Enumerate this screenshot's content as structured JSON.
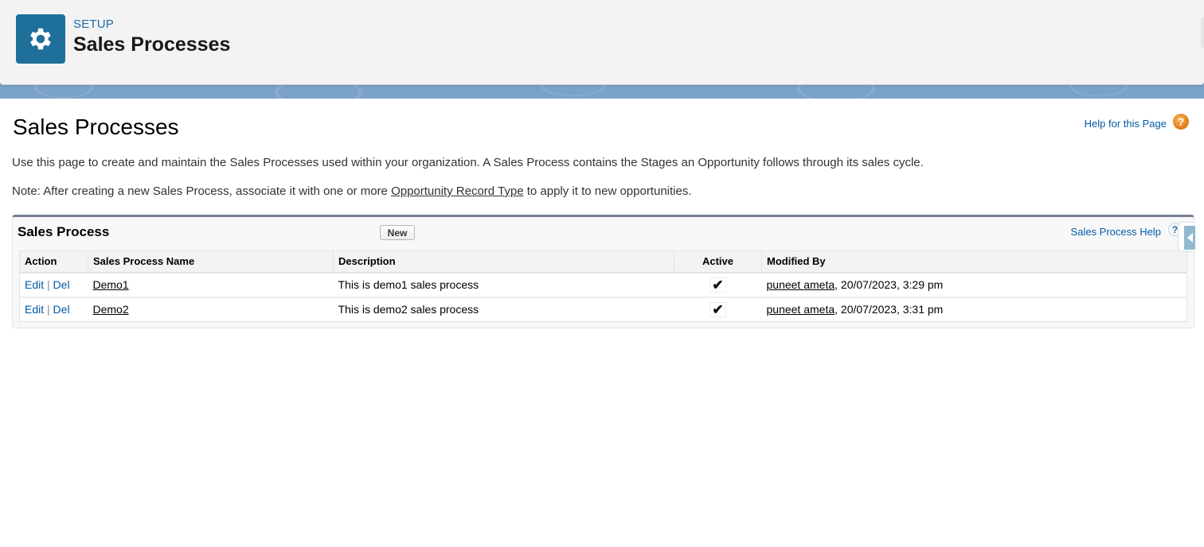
{
  "header": {
    "breadcrumb": "SETUP",
    "title": "Sales Processes",
    "icon": "gear-icon"
  },
  "page": {
    "title": "Sales Processes",
    "help_link": "Help for this Page",
    "help_icon": "?",
    "description": "Use this page to create and maintain the Sales Processes used within your organization. A Sales Process contains the Stages an Opportunity follows through its sales cycle.",
    "note_prefix": "Note: After creating a new Sales Process, associate it with one or more ",
    "note_link": "Opportunity Record Type",
    "note_suffix": " to apply it to new opportunities."
  },
  "panel": {
    "title": "Sales Process",
    "new_button": "New",
    "help_link": "Sales Process Help",
    "help_icon": "?",
    "columns": [
      "Action",
      "Sales Process Name",
      "Description",
      "Active",
      "Modified By"
    ],
    "rows": [
      {
        "edit": "Edit",
        "separator": "|",
        "del": "Del",
        "name": "Demo1",
        "description": "This is demo1 sales process",
        "active": "✔",
        "modified_user": "puneet ameta",
        "modified_date": ", 20/07/2023, 3:29 pm"
      },
      {
        "edit": "Edit",
        "separator": "|",
        "del": "Del",
        "name": "Demo2",
        "description": "This is demo2 sales process",
        "active": "✔",
        "modified_user": "puneet ameta",
        "modified_date": ", 20/07/2023, 3:31 pm"
      }
    ]
  },
  "colors": {
    "brand_icon_bg": "#1f6f9b",
    "link": "#015ba7",
    "panel_top_border": "#747e96",
    "help_orb": "#e07b13"
  }
}
